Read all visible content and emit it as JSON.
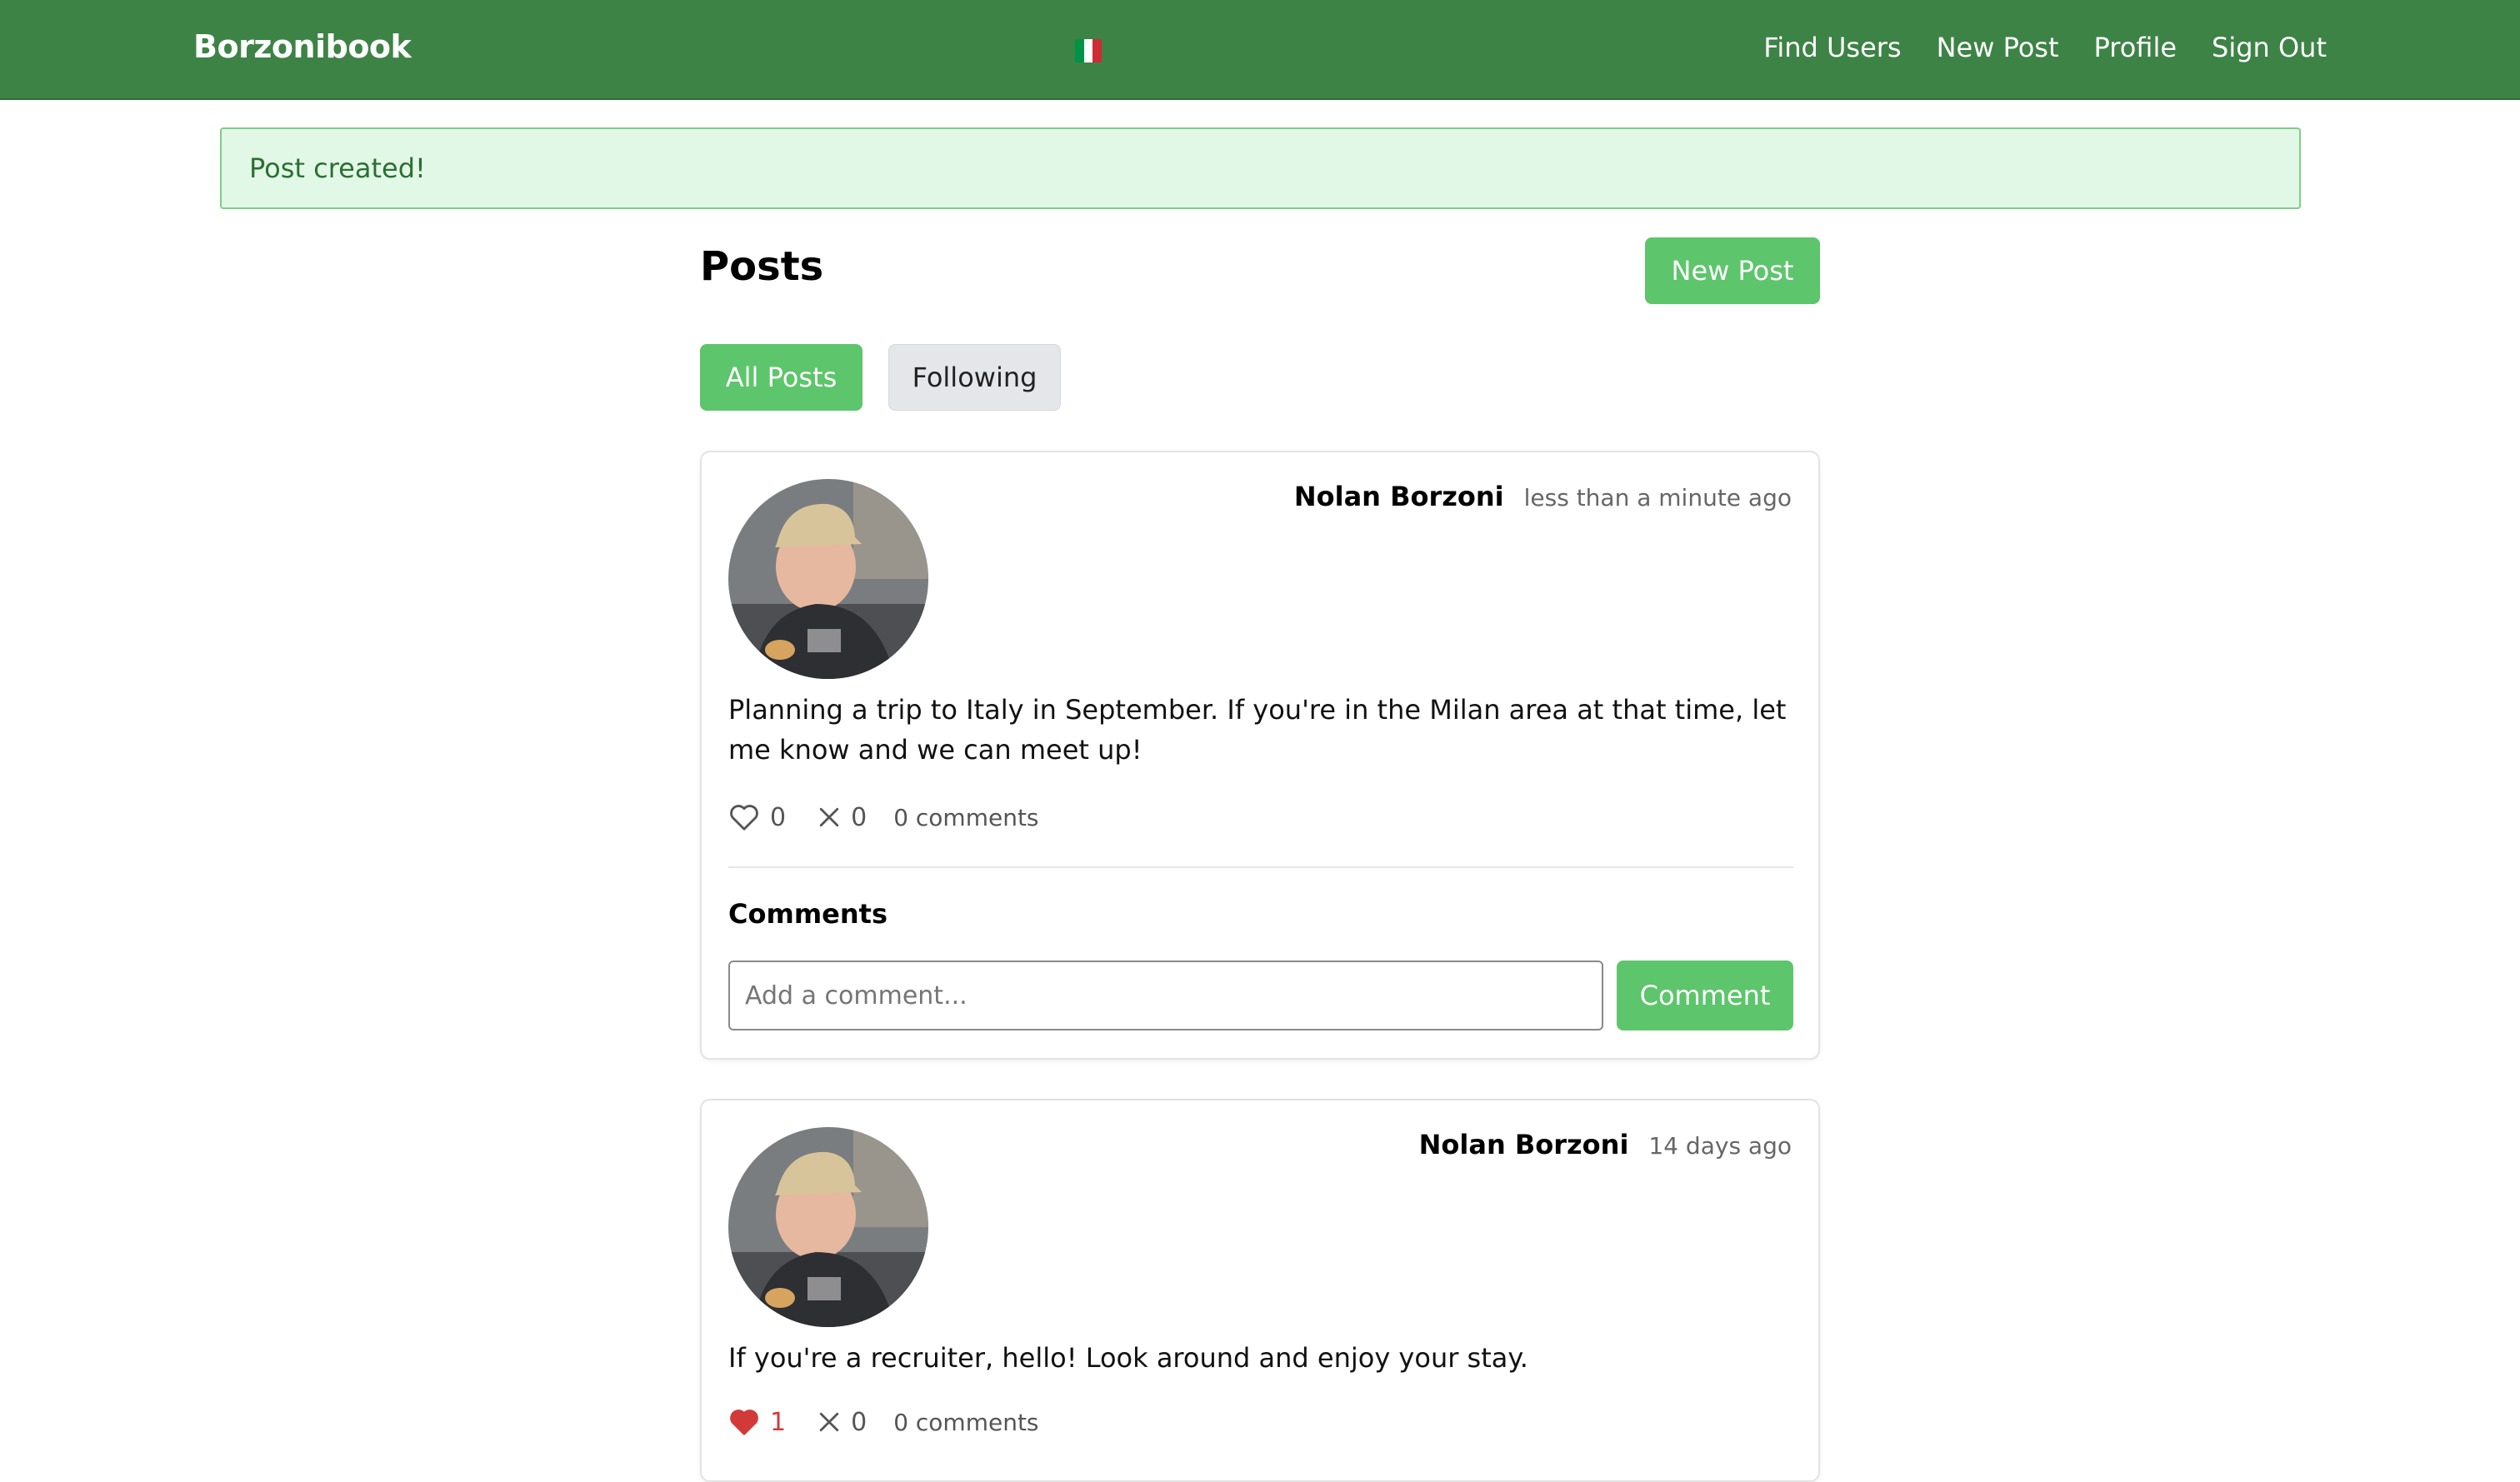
{
  "navbar": {
    "brand": "Borzonibook",
    "flag": [
      "#009246",
      "#ffffff",
      "#ce2b37"
    ],
    "links": [
      "Find Users",
      "New Post",
      "Profile",
      "Sign Out"
    ]
  },
  "alert": {
    "message": "Post created!"
  },
  "page": {
    "title": "Posts",
    "new_post_label": "New Post",
    "filters": {
      "all": "All Posts",
      "following": "Following"
    }
  },
  "colors": {
    "navbar": "#3d8346",
    "accent_green": "#5dc56b",
    "alert_bg": "#e2f8e6",
    "heart": "#d23a3a"
  },
  "posts": [
    {
      "author": "Nolan Borzoni",
      "time": "less than a minute ago",
      "body": "Planning a trip to Italy in September. If you're in the Milan area at that time, let me know and we can meet up!",
      "likes": "0",
      "dislikes": "0",
      "comments": "0 comments",
      "comments_heading": "Comments",
      "comment_placeholder": "Add a comment...",
      "comment_button": "Comment"
    },
    {
      "author": "Nolan Borzoni",
      "time": "14 days ago",
      "body": "If you're a recruiter, hello! Look around and enjoy your stay.",
      "likes": "1",
      "dislikes": "0",
      "comments": "0 comments"
    }
  ]
}
